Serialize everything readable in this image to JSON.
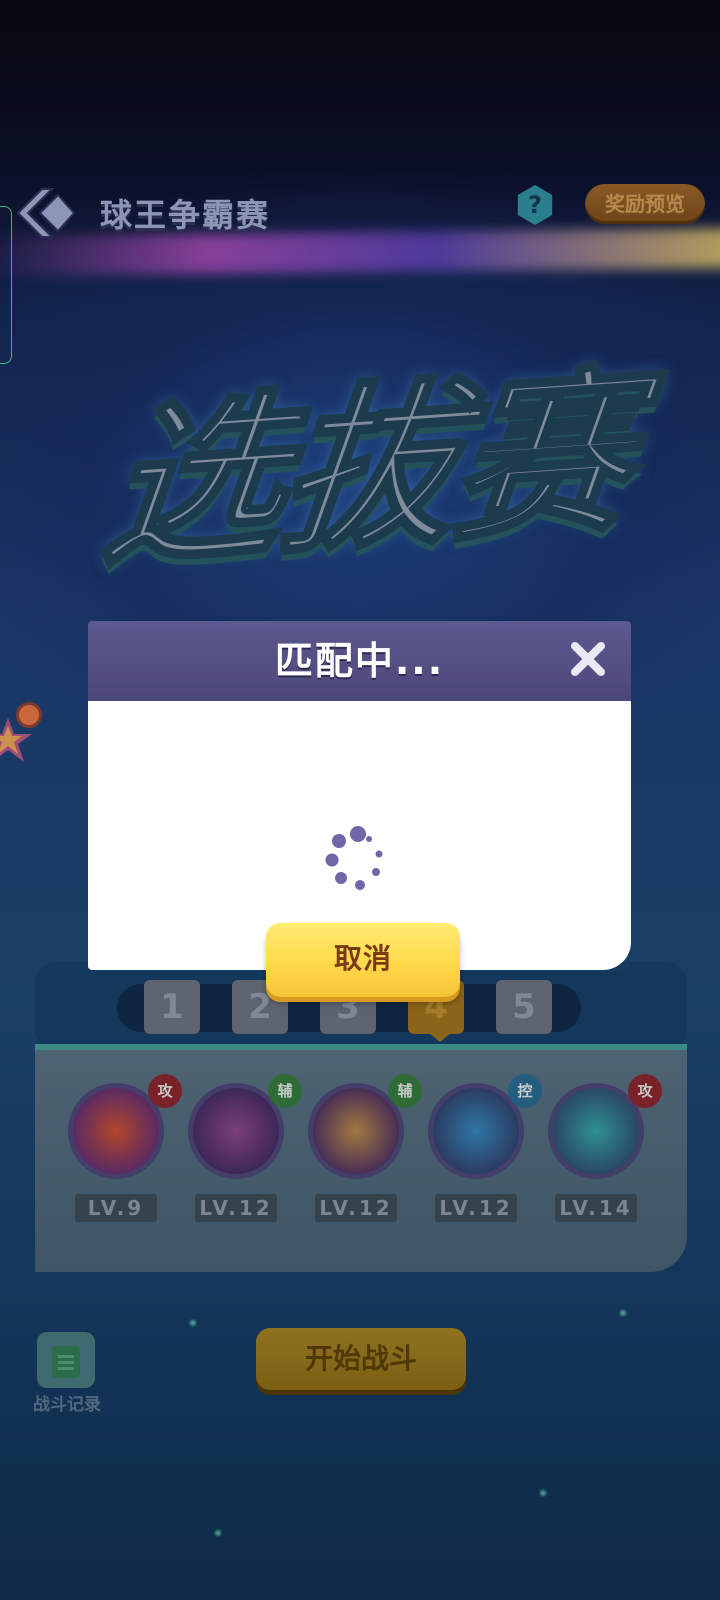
{
  "header": {
    "title": "球王争霸赛",
    "help_label": "?",
    "reward_label": "奖励预览"
  },
  "banner": {
    "text": "选拔赛"
  },
  "stage_tabs": {
    "items": [
      "1",
      "2",
      "3",
      "4",
      "5"
    ],
    "active_index": 3
  },
  "skills": [
    {
      "role": "攻",
      "level": "LV.9",
      "icon": "flame-crest-skill-icon"
    },
    {
      "role": "辅",
      "level": "LV.12",
      "icon": "leaf-swirl-skill-icon"
    },
    {
      "role": "辅",
      "level": "LV.12",
      "icon": "silhouette-skill-icon"
    },
    {
      "role": "控",
      "level": "LV.12",
      "icon": "wave-swirl-skill-icon"
    },
    {
      "role": "攻",
      "level": "LV.14",
      "icon": "arrow-burst-skill-icon"
    }
  ],
  "footer": {
    "record_label": "战斗记录",
    "start_label": "开始战斗"
  },
  "modal": {
    "title": "匹配中...",
    "cancel_label": "取消",
    "close_icon": "close-icon",
    "spinner_icon": "loading-spinner-icon"
  },
  "colors": {
    "modal_header": "#5c5990",
    "cancel_button": "#ffd94a",
    "cancel_text": "#7a3a13",
    "spinner": "#6f67a8"
  }
}
